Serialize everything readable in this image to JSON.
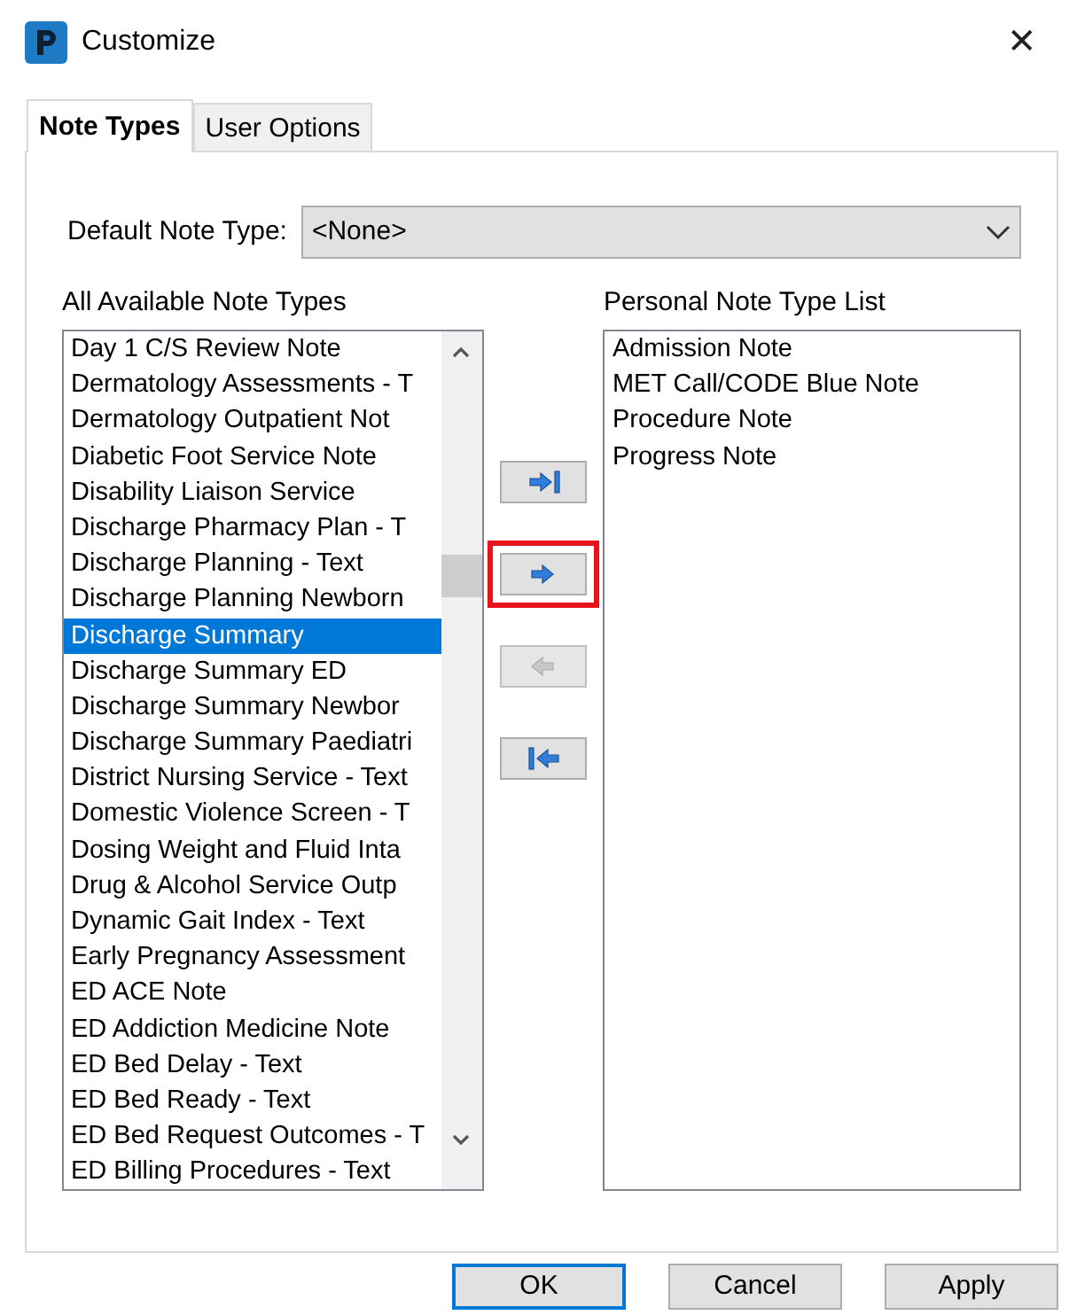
{
  "window": {
    "title": "Customize",
    "close": "✕"
  },
  "tabs": [
    {
      "label": "Note Types",
      "selected": true
    },
    {
      "label": "User Options",
      "selected": false
    }
  ],
  "default_note_type": {
    "label": "Default Note Type:",
    "value": "<None>"
  },
  "available": {
    "label": "All Available Note Types",
    "items": [
      {
        "text": "Day 1 C/S Review Note",
        "selected": false
      },
      {
        "text": "Dermatology Assessments - T",
        "selected": false
      },
      {
        "text": "Dermatology Outpatient Not",
        "selected": false
      },
      {
        "text": "Diabetic Foot Service Note",
        "selected": false
      },
      {
        "text": "Disability Liaison Service",
        "selected": false
      },
      {
        "text": "Discharge Pharmacy Plan - T",
        "selected": false
      },
      {
        "text": "Discharge Planning - Text",
        "selected": false
      },
      {
        "text": "Discharge Planning Newborn",
        "selected": false
      },
      {
        "text": "Discharge Summary",
        "selected": true
      },
      {
        "text": "Discharge Summary ED",
        "selected": false
      },
      {
        "text": "Discharge Summary Newbor",
        "selected": false
      },
      {
        "text": "Discharge Summary Paediatri",
        "selected": false
      },
      {
        "text": "District Nursing Service - Text",
        "selected": false
      },
      {
        "text": "Domestic Violence Screen - T",
        "selected": false
      },
      {
        "text": "Dosing Weight and Fluid Inta",
        "selected": false
      },
      {
        "text": "Drug & Alcohol Service Outp",
        "selected": false
      },
      {
        "text": "Dynamic Gait Index - Text",
        "selected": false
      },
      {
        "text": "Early Pregnancy Assessment",
        "selected": false
      },
      {
        "text": "ED ACE Note",
        "selected": false
      },
      {
        "text": "ED Addiction Medicine Note",
        "selected": false
      },
      {
        "text": "ED Bed Delay - Text",
        "selected": false
      },
      {
        "text": "ED Bed Ready - Text",
        "selected": false
      },
      {
        "text": "ED Bed Request Outcomes - T",
        "selected": false
      },
      {
        "text": "ED Billing Procedures - Text",
        "selected": false
      }
    ]
  },
  "move_buttons": [
    {
      "kind": "add_all",
      "disabled": false,
      "highlighted": false
    },
    {
      "kind": "add",
      "disabled": false,
      "highlighted": true
    },
    {
      "kind": "remove",
      "disabled": true,
      "highlighted": false
    },
    {
      "kind": "remove_all",
      "disabled": false,
      "highlighted": false
    }
  ],
  "personal": {
    "label": "Personal Note Type List",
    "items": [
      {
        "text": "Admission Note",
        "selected": false
      },
      {
        "text": "MET Call/CODE Blue Note",
        "selected": false
      },
      {
        "text": "Procedure Note",
        "selected": false
      },
      {
        "text": "Progress Note",
        "selected": false
      }
    ]
  },
  "buttons": [
    {
      "label": "OK",
      "default": true
    },
    {
      "label": "Cancel",
      "default": false
    },
    {
      "label": "Apply",
      "default": false
    }
  ]
}
